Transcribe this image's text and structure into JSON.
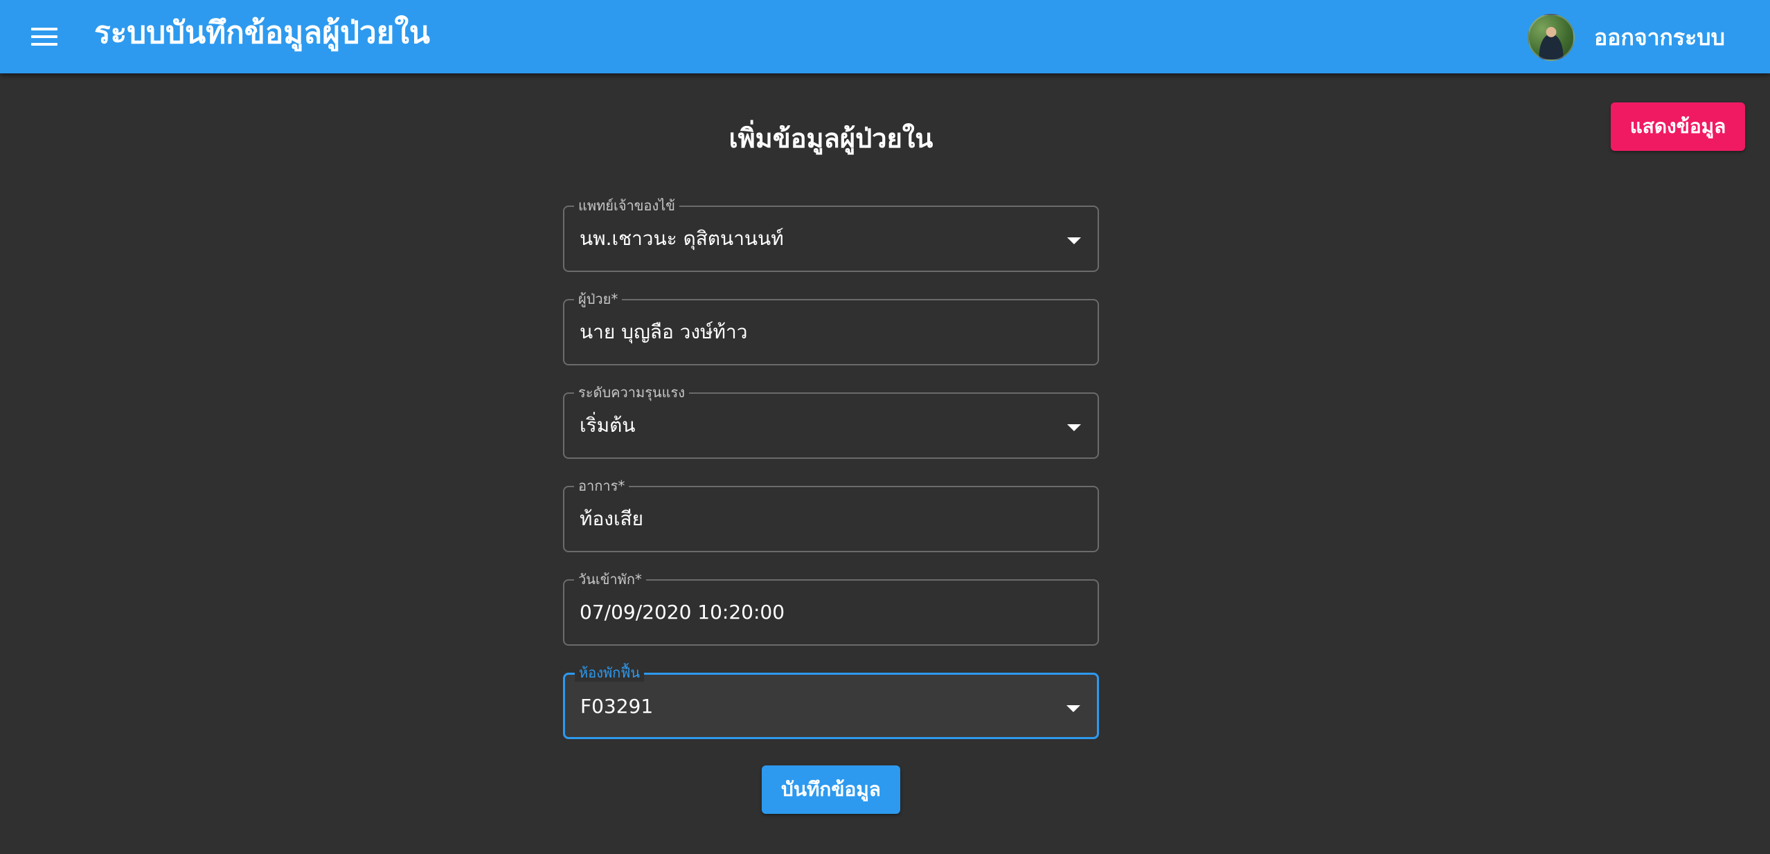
{
  "header": {
    "title": "ระบบบันทึกข้อมูลผู้ป่วยใน",
    "logout_label": "ออกจากระบบ"
  },
  "actions": {
    "show_data_label": "แสดงข้อมูล",
    "save_label": "บันทึกข้อมูล"
  },
  "form": {
    "title": "เพิ่มข้อมูลผู้ป่วยใน",
    "fields": [
      {
        "label": "แพทย์เจ้าของไข้",
        "value": "นพ.เชาวนะ ดุสิตนานนท์",
        "type": "select"
      },
      {
        "label": "ผู้ป่วย*",
        "value": "นาย บุญลือ วงษ์ท้าว",
        "type": "text"
      },
      {
        "label": "ระดับความรุนแรง",
        "value": "เริ่มต้น",
        "type": "select"
      },
      {
        "label": "อาการ*",
        "value": "ท้องเสีย",
        "type": "text"
      },
      {
        "label": "วันเข้าพัก*",
        "value": "07/09/2020 10:20:00",
        "type": "text"
      },
      {
        "label": "ห้องพักฟื้น",
        "value": "F03291",
        "type": "select",
        "focused": true
      }
    ]
  },
  "colors": {
    "appbar": "#2d9aef",
    "background": "#303030",
    "accent_pink": "#f01a63",
    "focus": "#2d9aef"
  },
  "icons": {
    "menu": "menu-icon",
    "dropdown": "arrow-drop-down-icon"
  }
}
